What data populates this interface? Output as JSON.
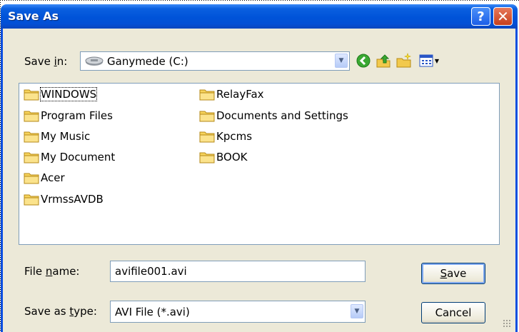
{
  "window": {
    "title": "Save As"
  },
  "save_in": {
    "label_pre": "Save ",
    "label_u": "i",
    "label_post": "n:",
    "location": "Ganymede (C:)"
  },
  "toolbar": {
    "back_icon": "back-icon",
    "up_icon": "up-folder-icon",
    "new_icon": "new-folder-icon",
    "views_icon": "views-icon"
  },
  "folders": [
    {
      "name": "WINDOWS"
    },
    {
      "name": "Program Files"
    },
    {
      "name": "My Music"
    },
    {
      "name": "My Document"
    },
    {
      "name": "Acer"
    },
    {
      "name": "VrmssAVDB"
    },
    {
      "name": "RelayFax"
    },
    {
      "name": "Documents and Settings"
    },
    {
      "name": "Kpcms"
    },
    {
      "name": "BOOK"
    }
  ],
  "file_name": {
    "label_pre": "File ",
    "label_u": "n",
    "label_post": "ame:",
    "value": "avifile001.avi"
  },
  "save_type": {
    "label_pre": "Save as ",
    "label_u": "t",
    "label_post": "ype:",
    "value": "AVI File (*.avi)"
  },
  "buttons": {
    "save_u": "S",
    "save_rest": "ave",
    "cancel": "Cancel"
  },
  "colors": {
    "titlebar": "#0053d8",
    "dialog_bg": "#ece9d8",
    "folder": "#f6d35b"
  }
}
